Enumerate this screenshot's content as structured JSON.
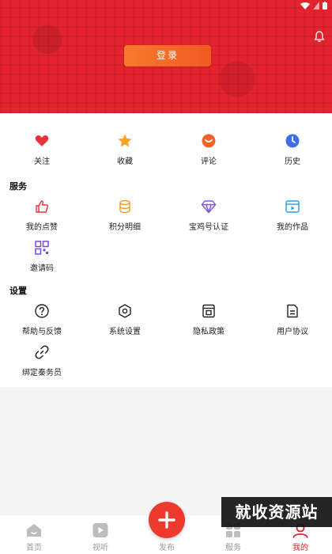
{
  "header": {
    "login_label": "登录",
    "bg_color": "#e3232e"
  },
  "top_row": [
    {
      "label": "关注",
      "icon": "heart-icon"
    },
    {
      "label": "收藏",
      "icon": "star-icon"
    },
    {
      "label": "评论",
      "icon": "comment-icon"
    },
    {
      "label": "历史",
      "icon": "clock-icon"
    }
  ],
  "services": {
    "title": "服务",
    "items": [
      {
        "label": "我的点赞",
        "icon": "thumbs-up-icon"
      },
      {
        "label": "积分明细",
        "icon": "coins-icon"
      },
      {
        "label": "宝鸡号认证",
        "icon": "diamond-icon"
      },
      {
        "label": "我的作品",
        "icon": "video-icon"
      },
      {
        "label": "邀请码",
        "icon": "qr-code-icon"
      }
    ]
  },
  "settings": {
    "title": "设置",
    "items": [
      {
        "label": "帮助与反馈",
        "icon": "help-icon"
      },
      {
        "label": "系统设置",
        "icon": "settings-icon"
      },
      {
        "label": "隐私政策",
        "icon": "privacy-icon"
      },
      {
        "label": "用户协议",
        "icon": "document-icon"
      },
      {
        "label": "绑定秦务员",
        "icon": "link-icon"
      }
    ]
  },
  "tabbar": {
    "items": [
      {
        "label": "首页",
        "icon": "home-icon"
      },
      {
        "label": "视听",
        "icon": "play-icon"
      },
      {
        "label": "发布",
        "icon": "plus-icon"
      },
      {
        "label": "服务",
        "icon": "grid-icon"
      },
      {
        "label": "我的",
        "icon": "profile-icon"
      }
    ],
    "active": "我的",
    "active_color": "#e3232e"
  },
  "watermark": "就收资源站"
}
